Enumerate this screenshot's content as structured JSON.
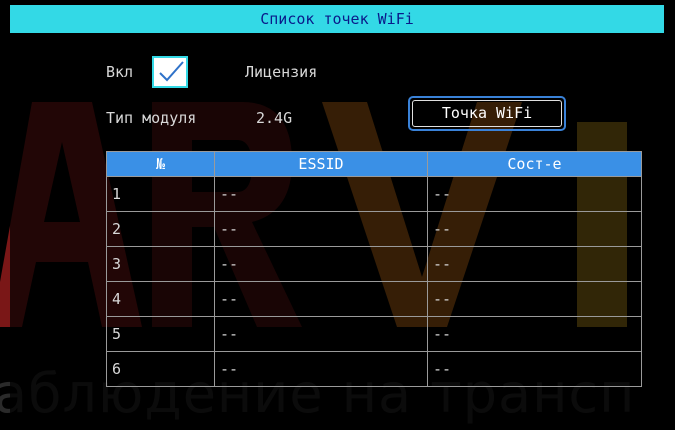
{
  "title": "Список точек WiFi",
  "enable": {
    "label": "Вкл",
    "checked": true
  },
  "license_label": "Лицензия",
  "module_type": {
    "label": "Тип модуля",
    "value": "2.4G"
  },
  "wifi_point_button": "Точка WiFi",
  "table": {
    "columns": [
      "№",
      "ESSID",
      "Сост-е"
    ],
    "rows": [
      [
        "1",
        "--",
        "--"
      ],
      [
        "2",
        "--",
        "--"
      ],
      [
        "3",
        "--",
        "--"
      ],
      [
        "4",
        "--",
        "--"
      ],
      [
        "5",
        "--",
        "--"
      ],
      [
        "6",
        "--",
        "--"
      ]
    ]
  },
  "watermark": {
    "letters": "ARVI",
    "text": "аблюдение на трансп"
  },
  "colors": {
    "title_bar": "#33d9e6",
    "title_text": "#0a1a8a",
    "table_header": "#3a90e6",
    "button_border": "#3a82d8",
    "watermark_red": "#7a1717",
    "watermark_orange": "#c26d16",
    "watermark_gold": "#b08a1a"
  }
}
